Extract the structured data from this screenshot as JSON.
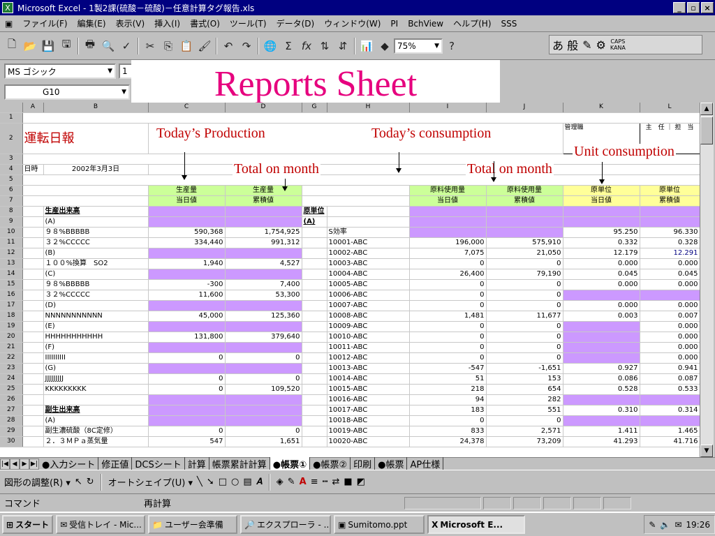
{
  "window": {
    "title": "Microsoft Excel - 1製2課(硫酸－硫酸)－任意計算タグ報告.xls"
  },
  "menu": [
    "ファイル(F)",
    "編集(E)",
    "表示(V)",
    "挿入(I)",
    "書式(O)",
    "ツール(T)",
    "データ(D)",
    "ウィンドウ(W)",
    "PI",
    "BchView",
    "ヘルプ(H)",
    "SSS"
  ],
  "toolbar": {
    "zoom": "75%"
  },
  "ime": {
    "mode": "あ 般",
    "caps": "CAPS",
    "kana": "KANA"
  },
  "format": {
    "font": "MS ゴシック",
    "size": "1"
  },
  "namebox": "G10",
  "overlay": {
    "title": "Reports Sheet"
  },
  "annotations": {
    "production": "Today’s Production",
    "consumption": "Today’s consumption",
    "total1": "Total on month",
    "total2": "Total on month",
    "unit": "Unit consumption"
  },
  "columns": [
    "",
    "A",
    "B",
    "C",
    "D",
    "G",
    "H",
    "I",
    "J",
    "K",
    "L"
  ],
  "sheet": {
    "title": "運転日報",
    "date_label": "日時",
    "date_value": "2002年3月3日",
    "approval": [
      "管理職",
      "主　任",
      "担　当"
    ],
    "hdr_prod": [
      "生産量",
      "当日値",
      "生産量",
      "累積値"
    ],
    "hdr_cons": [
      "原料使用量",
      "当日値",
      "原料使用量",
      "累積値"
    ],
    "hdr_unit": [
      "原単位",
      "当日値",
      "原単位",
      "累積値"
    ],
    "sec1": "生産出来高",
    "sec2": "原単位",
    "sec3": "副生出来高"
  },
  "rows": [
    {
      "r": "8",
      "b": "生産出来高",
      "c": "",
      "d": "",
      "g": "原単位",
      "h": "",
      "i": "",
      "j": "",
      "k": "",
      "l": ""
    },
    {
      "r": "9",
      "b": "(A)",
      "c": "",
      "d": "",
      "g": "(A)",
      "h": "",
      "i": "",
      "j": "",
      "k": "",
      "l": ""
    },
    {
      "r": "10",
      "b": "９８%BBBBB",
      "c": "590,368",
      "d": "1,754,925",
      "g": "",
      "h": "S効率",
      "i": "",
      "j": "",
      "k": "95.250",
      "l": "96.330"
    },
    {
      "r": "11",
      "b": "３２%CCCCC",
      "c": "334,440",
      "d": "991,312",
      "g": "",
      "h": "10001-ABC",
      "i": "196,000",
      "j": "575,910",
      "k": "0.332",
      "l": "0.328"
    },
    {
      "r": "12",
      "b": "(B)",
      "c": "",
      "d": "",
      "g": "",
      "h": "10002-ABC",
      "i": "7,075",
      "j": "21,050",
      "k": "12.179",
      "l": "12.291"
    },
    {
      "r": "13",
      "b": "１００%換算　SO2",
      "c": "1,940",
      "d": "4,527",
      "g": "",
      "h": "10003-ABC",
      "i": "0",
      "j": "0",
      "k": "0.000",
      "l": "0.000"
    },
    {
      "r": "14",
      "b": "(C)",
      "c": "",
      "d": "",
      "g": "",
      "h": "10004-ABC",
      "i": "26,400",
      "j": "79,190",
      "k": "0.045",
      "l": "0.045"
    },
    {
      "r": "15",
      "b": "９８%BBBBB",
      "c": "-300",
      "d": "7,400",
      "g": "",
      "h": "10005-ABC",
      "i": "0",
      "j": "0",
      "k": "0.000",
      "l": "0.000"
    },
    {
      "r": "16",
      "b": "３２%CCCCC",
      "c": "11,600",
      "d": "53,300",
      "g": "",
      "h": "10006-ABC",
      "i": "0",
      "j": "0",
      "k": "",
      "l": ""
    },
    {
      "r": "17",
      "b": "(D)",
      "c": "",
      "d": "",
      "g": "",
      "h": "10007-ABC",
      "i": "0",
      "j": "0",
      "k": "0.000",
      "l": "0.000"
    },
    {
      "r": "18",
      "b": "NNNNNNNNNNN",
      "c": "45,000",
      "d": "125,360",
      "g": "",
      "h": "10008-ABC",
      "i": "1,481",
      "j": "11,677",
      "k": "0.003",
      "l": "0.007"
    },
    {
      "r": "19",
      "b": "(E)",
      "c": "",
      "d": "",
      "g": "",
      "h": "10009-ABC",
      "i": "0",
      "j": "0",
      "k": "",
      "l": "0.000"
    },
    {
      "r": "20",
      "b": "HHHHHHHHHHH",
      "c": "131,800",
      "d": "379,640",
      "g": "",
      "h": "10010-ABC",
      "i": "0",
      "j": "0",
      "k": "",
      "l": "0.000"
    },
    {
      "r": "21",
      "b": "(F)",
      "c": "",
      "d": "",
      "g": "",
      "h": "10011-ABC",
      "i": "0",
      "j": "0",
      "k": "",
      "l": "0.000"
    },
    {
      "r": "22",
      "b": "IIIIIIIIII",
      "c": "0",
      "d": "0",
      "g": "",
      "h": "10012-ABC",
      "i": "0",
      "j": "0",
      "k": "",
      "l": "0.000"
    },
    {
      "r": "23",
      "b": "(G)",
      "c": "",
      "d": "",
      "g": "",
      "h": "10013-ABC",
      "i": "-547",
      "j": "-1,651",
      "k": "0.927",
      "l": "0.941"
    },
    {
      "r": "24",
      "b": "JJJJJJJJJ",
      "c": "0",
      "d": "0",
      "g": "",
      "h": "10014-ABC",
      "i": "51",
      "j": "153",
      "k": "0.086",
      "l": "0.087"
    },
    {
      "r": "25",
      "b": "KKKKKKKKK",
      "c": "0",
      "d": "109,520",
      "g": "",
      "h": "10015-ABC",
      "i": "218",
      "j": "654",
      "k": "0.528",
      "l": "0.533"
    },
    {
      "r": "26",
      "b": "",
      "c": "",
      "d": "",
      "g": "",
      "h": "10016-ABC",
      "i": "94",
      "j": "282",
      "k": "",
      "l": ""
    },
    {
      "r": "27",
      "b": "副生出来高",
      "c": "",
      "d": "",
      "g": "",
      "h": "10017-ABC",
      "i": "183",
      "j": "551",
      "k": "0.310",
      "l": "0.314"
    },
    {
      "r": "28",
      "b": "(A)",
      "c": "",
      "d": "",
      "g": "",
      "h": "10018-ABC",
      "i": "0",
      "j": "0",
      "k": "",
      "l": ""
    },
    {
      "r": "29",
      "b": "副生濃硫酸（8C定修）",
      "c": "0",
      "d": "0",
      "g": "",
      "h": "10019-ABC",
      "i": "833",
      "j": "2,571",
      "k": "1.411",
      "l": "1.465"
    },
    {
      "r": "30",
      "b": "２．３ＭＰａ蒸気量",
      "c": "547",
      "d": "1,651",
      "g": "",
      "h": "10020-ABC",
      "i": "24,378",
      "j": "73,209",
      "k": "41.293",
      "l": "41.716"
    }
  ],
  "sheet_tabs": [
    "入力シート",
    "修正値",
    "DCSシート",
    "計算",
    "帳票累計計算",
    "帳票①",
    "帳票②",
    "印刷",
    "帳票",
    "AP仕様"
  ],
  "active_tab": "帳票①",
  "drawbar": {
    "adjust": "図形の調整(R)",
    "autoshape": "オートシェイプ(U)"
  },
  "status": {
    "mode": "コマンド",
    "text": "再計算"
  },
  "taskbar": {
    "start": "スタート",
    "items": [
      "受信トレイ - Mic...",
      "ユーザー会準備",
      "エクスプローラ - ...",
      "Sumitomo.ppt",
      "Microsoft E..."
    ],
    "time": "19:26"
  }
}
